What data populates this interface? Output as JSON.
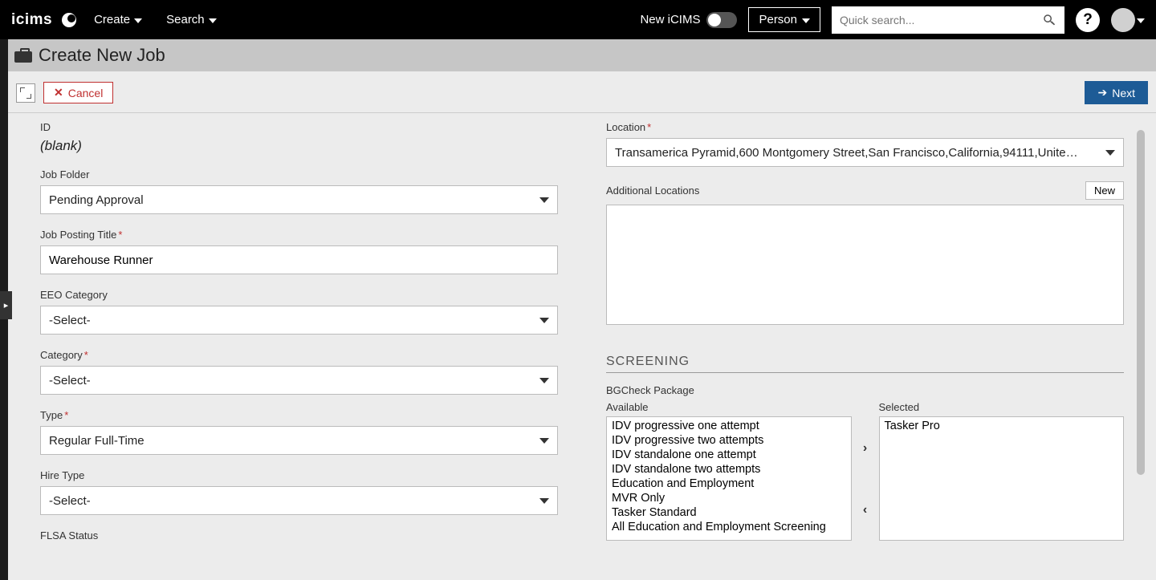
{
  "nav": {
    "logo": "icims",
    "create": "Create",
    "search": "Search",
    "toggle_label": "New iCIMS",
    "search_type": "Person",
    "search_placeholder": "Quick search..."
  },
  "page": {
    "title": "Create New Job",
    "cancel": "Cancel",
    "next": "Next"
  },
  "left": {
    "id_label": "ID",
    "id_value": "(blank)",
    "folder_label": "Job Folder",
    "folder_value": "Pending Approval",
    "title_label": "Job Posting Title",
    "title_value": "Warehouse Runner",
    "eeo_label": "EEO Category",
    "eeo_value": "-Select-",
    "category_label": "Category",
    "category_value": "-Select-",
    "type_label": "Type",
    "type_value": "Regular Full-Time",
    "hire_label": "Hire Type",
    "hire_value": "-Select-",
    "flsa_label": "FLSA Status"
  },
  "right": {
    "location_label": "Location",
    "location_value": "Transamerica Pyramid,600 Montgomery Street,San Francisco,California,94111,Unite…",
    "addl_label": "Additional Locations",
    "new_btn": "New",
    "screening_head": "SCREENING",
    "bgcheck_label": "BGCheck Package",
    "available_label": "Available",
    "selected_label": "Selected",
    "available": [
      "IDV progressive one attempt",
      "IDV progressive two attempts",
      "IDV standalone one attempt",
      "IDV standalone two attempts",
      "Education and Employment",
      "MVR Only",
      "Tasker Standard",
      "All Education and Employment Screening"
    ],
    "selected": [
      "Tasker Pro"
    ]
  }
}
